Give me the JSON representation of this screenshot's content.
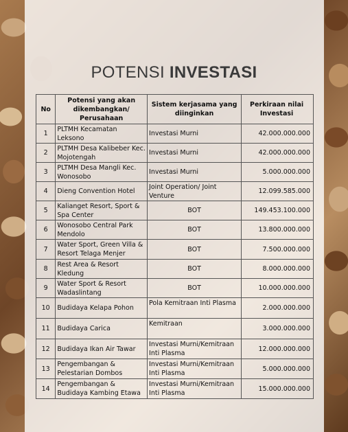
{
  "title": {
    "normal": "POTENSI",
    "bold": "INVESTASI"
  },
  "table": {
    "headers": {
      "no": "No",
      "potensi": "Potensi yang akan dikembangkan/ Perusahaan",
      "sistem": "Sistem kerjasama yang diinginkan",
      "investasi": "Perkiraan nilai Investasi"
    },
    "rows": [
      {
        "no": "1",
        "potensi": "PLTMH Kecamatan Leksono",
        "sistem": "Investasi Murni",
        "investasi": "42.000.000.000"
      },
      {
        "no": "2",
        "potensi": "PLTMH Desa Kalibeber Kec. Mojotengah",
        "sistem": "Investasi Murni",
        "investasi": "42.000.000.000"
      },
      {
        "no": "3",
        "potensi": "PLTMH Desa Mangli Kec. Wonosobo",
        "sistem": "Investasi Murni",
        "investasi": "5.000.000.000"
      },
      {
        "no": "4",
        "potensi": "Dieng Convention Hotel",
        "sistem": "Joint Operation/ Joint Venture",
        "investasi": "12.099.585.000"
      },
      {
        "no": "5",
        "potensi": "Kalianget Resort, Sport & Spa Center",
        "sistem": "BOT",
        "investasi": "149.453.100.000"
      },
      {
        "no": "6",
        "potensi": "Wonosobo Central Park Mendolo",
        "sistem": "BOT",
        "investasi": "13.800.000.000"
      },
      {
        "no": "7",
        "potensi": "Water Sport, Green Villa & Resort Telaga Menjer",
        "sistem": "BOT",
        "investasi": "7.500.000.000"
      },
      {
        "no": "8",
        "potensi": "Rest Area & Resort Kledung",
        "sistem": "BOT",
        "investasi": "8.000.000.000"
      },
      {
        "no": "9",
        "potensi": "Water Sport & Resort Wadaslintang",
        "sistem": "BOT",
        "investasi": "10.000.000.000"
      },
      {
        "no": "10",
        "potensi": "Budidaya Kelapa Pohon",
        "sistem": "Pola Kemitraan Inti Plasma",
        "investasi": "2.000.000.000"
      },
      {
        "no": "11",
        "potensi": "Budidaya Carica",
        "sistem": "Kemitraan",
        "investasi": "3.000.000.000"
      },
      {
        "no": "12",
        "potensi": "Budidaya Ikan Air Tawar",
        "sistem": "Investasi Murni/Kemitraan Inti Plasma",
        "investasi": "12.000.000.000"
      },
      {
        "no": "13",
        "potensi": "Pengembangan & Pelestarian Dombos",
        "sistem": "Investasi Murni/Kemitraan Inti Plasma",
        "investasi": "5.000.000.000"
      },
      {
        "no": "14",
        "potensi": "Pengembangan & Budidaya Kambing Etawa",
        "sistem": "Investasi Murni/Kemitraan Inti Plasma",
        "investasi": "15.000.000.000"
      }
    ]
  }
}
